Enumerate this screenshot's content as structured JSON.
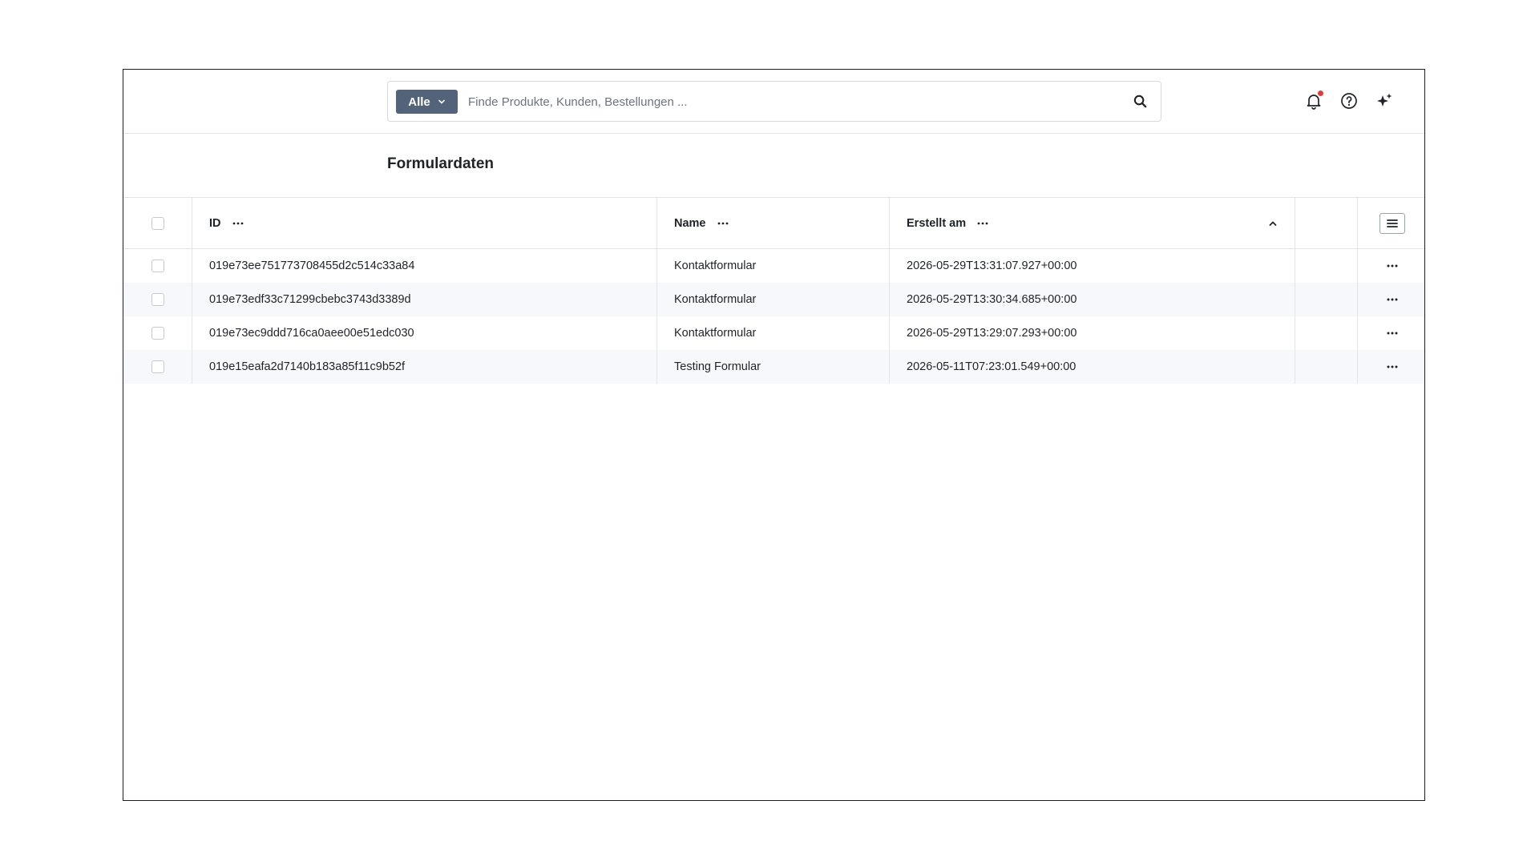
{
  "search": {
    "scope_label": "Alle",
    "placeholder": "Finde Produkte, Kunden, Bestellungen ..."
  },
  "page": {
    "title": "Formulardaten"
  },
  "table": {
    "columns": {
      "id": "ID",
      "name": "Name",
      "created": "Erstellt am"
    },
    "sort": {
      "column": "created",
      "direction": "ascending"
    },
    "rows": [
      {
        "id": "019e73ee751773708455d2c514c33a84",
        "name": "Kontaktformular",
        "created": "2026-05-29T13:31:07.927+00:00"
      },
      {
        "id": "019e73edf33c71299cbebc3743d3389d",
        "name": "Kontaktformular",
        "created": "2026-05-29T13:30:34.685+00:00"
      },
      {
        "id": "019e73ec9ddd716ca0aee00e51edc030",
        "name": "Kontaktformular",
        "created": "2026-05-29T13:29:07.293+00:00"
      },
      {
        "id": "019e15eafa2d7140b183a85f11c9b52f",
        "name": "Testing Formular",
        "created": "2026-05-11T07:23:01.549+00:00"
      }
    ]
  },
  "icons": {
    "notifications": "bell-icon",
    "help": "help-circle-icon",
    "ai": "sparkle-icon",
    "search": "search-icon"
  },
  "colors": {
    "scope_button": "#52637a",
    "notification_dot": "#e23b3b",
    "row_alt": "#f6f8fb"
  }
}
